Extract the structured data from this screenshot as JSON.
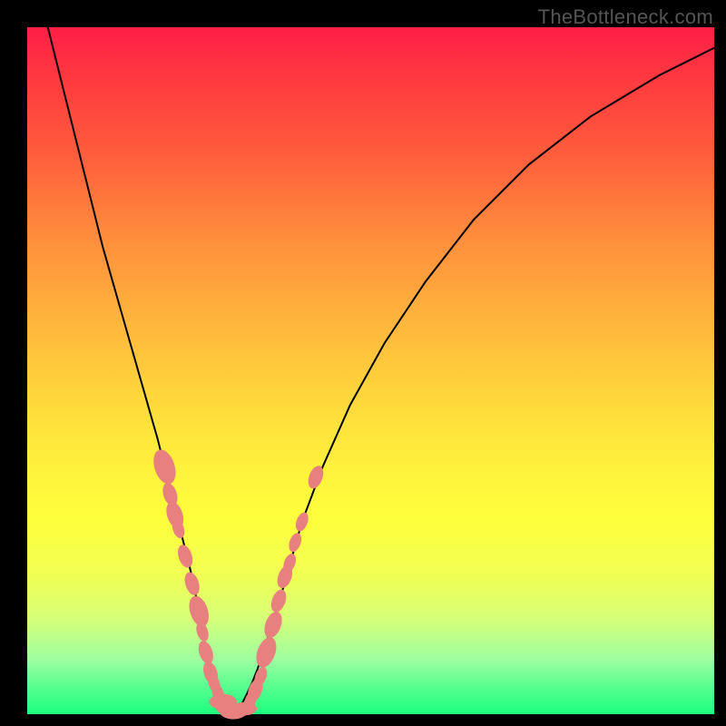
{
  "watermark": "TheBottleneck.com",
  "colors": {
    "gradient_top": "#ff1f47",
    "gradient_mid": "#ffe83c",
    "gradient_bottom": "#1bff7e",
    "curve": "#000000",
    "scatter": "#e88080",
    "frame": "#000000"
  },
  "chart_data": {
    "type": "line",
    "title": "",
    "xlabel": "",
    "ylabel": "",
    "xlim": [
      0,
      100
    ],
    "ylim": [
      0,
      100
    ],
    "grid": false,
    "legend": false,
    "series": [
      {
        "name": "left-curve",
        "x": [
          3,
          5,
          7,
          9,
          11,
          13,
          15,
          17,
          19,
          20,
          21,
          22,
          23,
          24,
          24.8,
          25.5,
          26,
          26.5,
          27,
          27.5,
          28,
          28.5,
          29,
          29.5,
          30
        ],
        "values": [
          100,
          92,
          84,
          76,
          68,
          61,
          54,
          47,
          40,
          36,
          32,
          28,
          24,
          20,
          16,
          12,
          9,
          7,
          5,
          3.5,
          2.5,
          1.8,
          1.2,
          0.6,
          0
        ]
      },
      {
        "name": "right-curve",
        "x": [
          30,
          30.5,
          31,
          31.5,
          32,
          32.7,
          33.5,
          34.5,
          36,
          38,
          40,
          43,
          47,
          52,
          58,
          65,
          73,
          82,
          92,
          100
        ],
        "values": [
          0,
          0.6,
          1.2,
          2.0,
          3.0,
          4.5,
          6.5,
          9.5,
          14,
          21,
          28,
          36,
          45,
          54,
          63,
          72,
          80,
          87,
          93,
          97
        ]
      }
    ],
    "scatter": {
      "name": "highlight-points",
      "points": [
        {
          "x": 20.0,
          "y": 36,
          "r": 1.8
        },
        {
          "x": 20.8,
          "y": 32,
          "r": 1.2
        },
        {
          "x": 21.5,
          "y": 29,
          "r": 1.4
        },
        {
          "x": 22.0,
          "y": 27,
          "r": 1.0
        },
        {
          "x": 23.0,
          "y": 23,
          "r": 1.2
        },
        {
          "x": 24.0,
          "y": 19,
          "r": 1.2
        },
        {
          "x": 25.0,
          "y": 15,
          "r": 1.6
        },
        {
          "x": 25.5,
          "y": 12,
          "r": 1.0
        },
        {
          "x": 26.0,
          "y": 9,
          "r": 1.2
        },
        {
          "x": 26.7,
          "y": 6,
          "r": 1.2
        },
        {
          "x": 27.2,
          "y": 4.5,
          "r": 1.0
        },
        {
          "x": 27.8,
          "y": 3.0,
          "r": 1.0
        },
        {
          "x": 28.5,
          "y": 1.8,
          "r": 1.4
        },
        {
          "x": 29.2,
          "y": 0.9,
          "r": 1.2
        },
        {
          "x": 30.0,
          "y": 0.4,
          "r": 1.4
        },
        {
          "x": 30.8,
          "y": 0.4,
          "r": 1.0
        },
        {
          "x": 31.7,
          "y": 0.8,
          "r": 1.2
        },
        {
          "x": 32.5,
          "y": 2.0,
          "r": 1.0
        },
        {
          "x": 33.2,
          "y": 3.5,
          "r": 1.2
        },
        {
          "x": 34.0,
          "y": 5.5,
          "r": 1.0
        },
        {
          "x": 34.8,
          "y": 9.0,
          "r": 1.6
        },
        {
          "x": 35.8,
          "y": 13.0,
          "r": 1.4
        },
        {
          "x": 36.6,
          "y": 16.5,
          "r": 1.2
        },
        {
          "x": 37.5,
          "y": 20.0,
          "r": 1.2
        },
        {
          "x": 38.2,
          "y": 22.0,
          "r": 1.0
        },
        {
          "x": 39.0,
          "y": 25.0,
          "r": 1.0
        },
        {
          "x": 40.0,
          "y": 28.0,
          "r": 1.0
        },
        {
          "x": 42.0,
          "y": 34.5,
          "r": 1.2
        }
      ]
    }
  }
}
